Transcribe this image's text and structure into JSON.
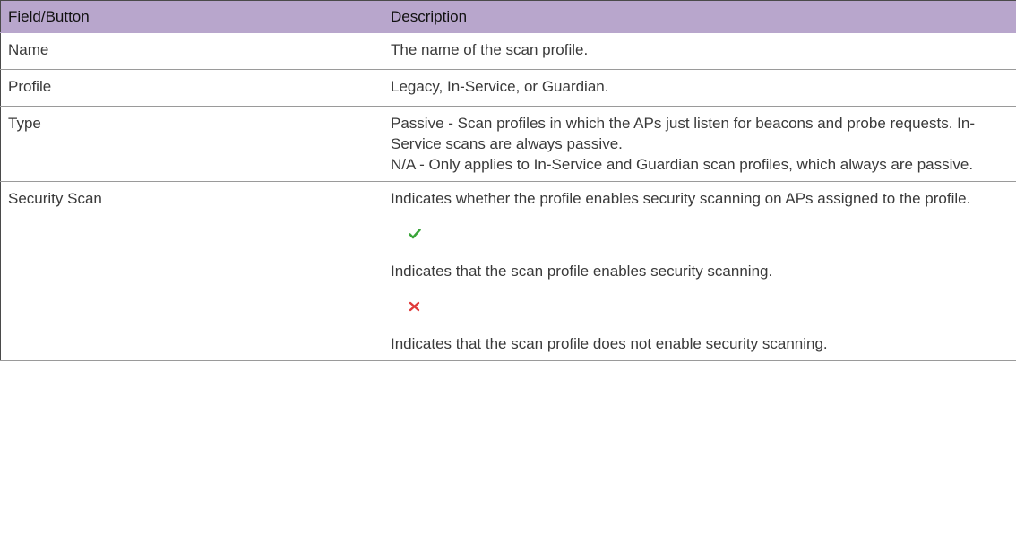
{
  "table": {
    "headers": {
      "field": "Field/Button",
      "description": "Description"
    },
    "rows": {
      "name": {
        "field": "Name",
        "description": "The name of the scan profile."
      },
      "profile": {
        "field": "Profile",
        "description": "Legacy, In-Service, or Guardian."
      },
      "type": {
        "field": "Type",
        "description_passive": "Passive - Scan profiles in which the APs just listen for beacons and probe requests. In-Service scans are always passive.",
        "description_na": "N/A - Only applies to In-Service and Guardian scan profiles, which always are passive."
      },
      "security_scan": {
        "field": "Security Scan",
        "description_intro": "Indicates whether the profile enables security scanning on APs assigned to the profile.",
        "enabled_icon": "check-icon",
        "enabled_text": "Indicates that the scan profile enables security scanning.",
        "disabled_icon": "x-icon",
        "disabled_text": "Indicates that the scan profile does not enable security scanning."
      }
    }
  },
  "colors": {
    "header_bg": "#b8a6cc",
    "check": "#3aa53a",
    "cross": "#e03a3a"
  }
}
